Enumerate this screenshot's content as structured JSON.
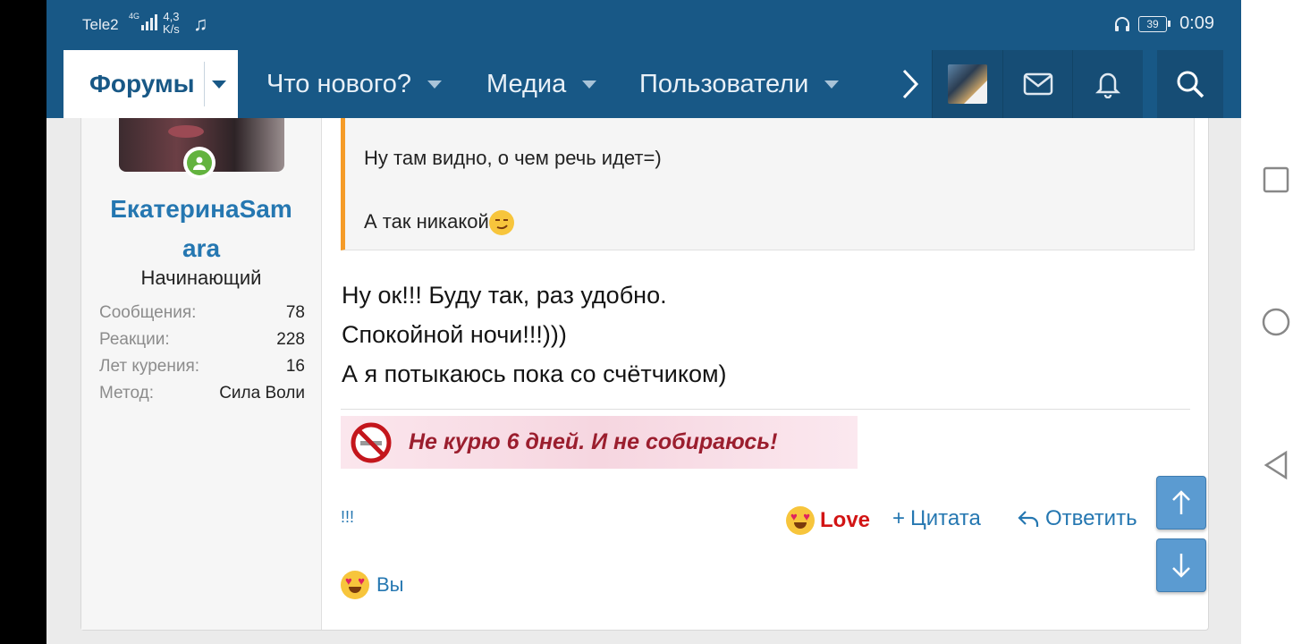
{
  "status_bar": {
    "carrier": "Tele2",
    "network": "4G",
    "speed_value": "4,3",
    "speed_unit": "K/s",
    "battery": "39",
    "time": "0:09"
  },
  "nav": {
    "forums": "Форумы",
    "whats_new": "Что нового?",
    "media": "Медиа",
    "members": "Пользователи"
  },
  "post": {
    "author": {
      "name": "ЕкатеринаSamara",
      "name_line1": "ЕкатеринаSam",
      "name_line2": "ara",
      "title": "Начинающий"
    },
    "stats": [
      {
        "label": "Сообщения:",
        "value": "78"
      },
      {
        "label": "Реакции:",
        "value": "228"
      },
      {
        "label": "Лет курения:",
        "value": "16"
      },
      {
        "label": "Метод:",
        "value": "Сила Воли"
      }
    ],
    "quote": {
      "line1": "Ну там видно, о чем речь идет=)",
      "line2": "А так никакой"
    },
    "body": [
      "Ну ок!!! Буду так, раз удобно.",
      "Спокойной ночи!!!)))",
      "А я потыкаюсь пока со счётчиком)"
    ],
    "signature": "Не курю 6 дней. И не собираюсь!",
    "actions": {
      "excl": "!!!",
      "love": "Love",
      "quote": "Цитата",
      "reply": "Ответить"
    },
    "reactions_by": "Вы"
  },
  "colors": {
    "brand": "#185886",
    "link": "#2577b1",
    "love": "#d21414",
    "quote_border": "#f59b28"
  }
}
